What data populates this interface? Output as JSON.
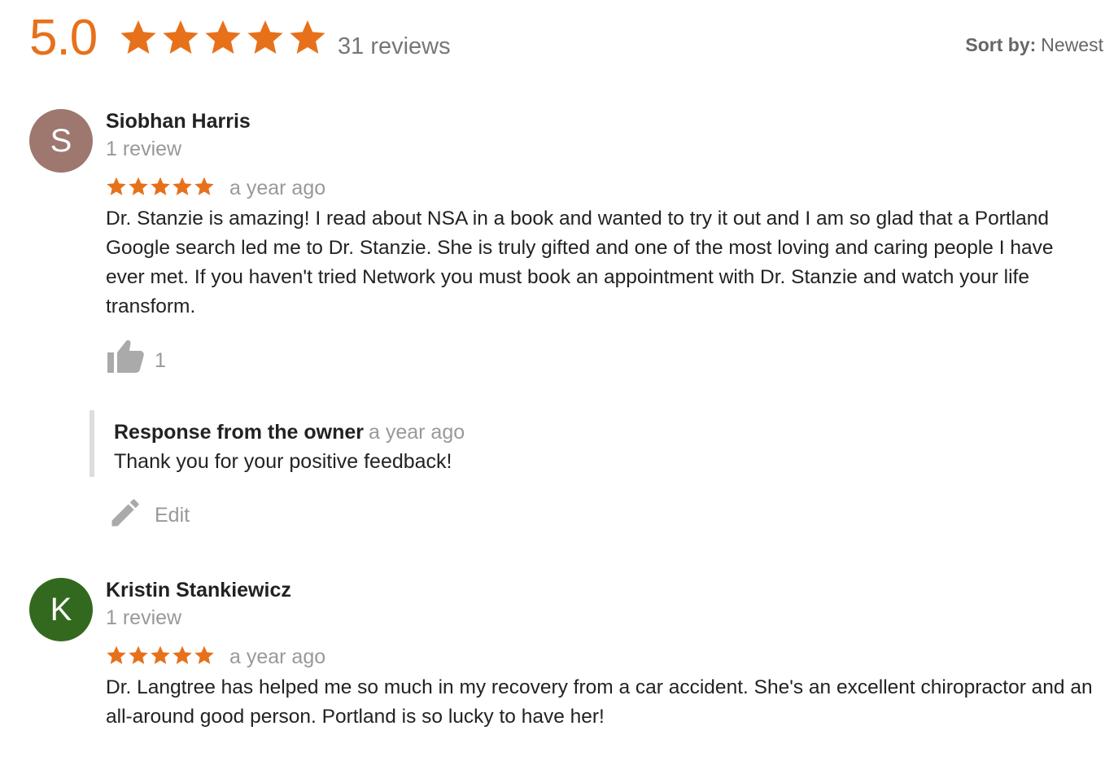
{
  "summary": {
    "rating": "5.0",
    "star_count": 5,
    "reviews_count": "31 reviews",
    "accent_color": "#e7711b"
  },
  "sort": {
    "label": "Sort by:",
    "value": "Newest"
  },
  "reviews": [
    {
      "avatar_letter": "S",
      "avatar_color": "#9e776f",
      "name": "Siobhan Harris",
      "meta": "1 review",
      "stars": 5,
      "date": "a year ago",
      "text": "Dr. Stanzie is amazing!  I read about NSA in a book and wanted to try it out and I am so glad that a Portland Google search led me to Dr. Stanzie.  She is truly gifted and one of the most loving and caring people I have ever met.  If you haven't tried Network you must book an appointment with Dr. Stanzie and watch your life transform.",
      "likes": "1",
      "like_icon": "thumbs-up-icon",
      "owner_response": {
        "label": "Response from the owner",
        "date": "a year ago",
        "text": "Thank you for your positive feedback!"
      },
      "edit_icon": "pencil-icon",
      "edit_label": "Edit"
    },
    {
      "avatar_letter": "K",
      "avatar_color": "#33691e",
      "name": "Kristin Stankiewicz",
      "meta": "1 review",
      "stars": 5,
      "date": "a year ago",
      "text": "Dr. Langtree has helped me so much in my recovery from a car accident.  She's an excellent chiropractor and an all-around good person.  Portland is so lucky to have her!"
    }
  ]
}
